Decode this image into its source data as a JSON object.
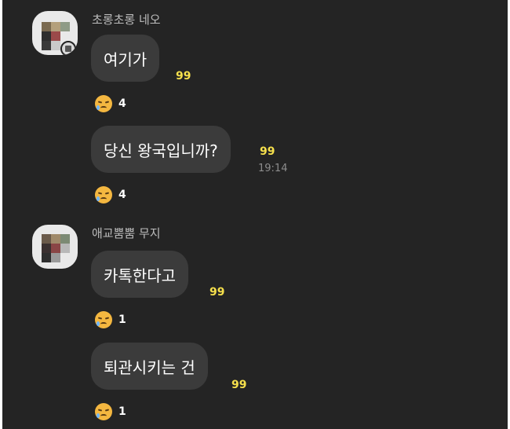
{
  "messages": [
    {
      "sender": "초롱초롱 네오",
      "bubbles": [
        {
          "text": "여기가",
          "unread": "99",
          "time": "",
          "reaction_count": "4"
        },
        {
          "text": "당신 왕국입니까?",
          "unread": "99",
          "time": "19:14",
          "reaction_count": "4"
        }
      ]
    },
    {
      "sender": "애교뿜뿜 무지",
      "bubbles": [
        {
          "text": "카톡한다고",
          "unread": "99",
          "time": "",
          "reaction_count": "1"
        },
        {
          "text": "퇴관시키는 건",
          "unread": "99",
          "time": "",
          "reaction_count": "1"
        }
      ]
    }
  ],
  "colors": {
    "background": "#242424",
    "bubble": "#3b3b3b",
    "unread": "#f6e04c",
    "reaction_emoji": "#f4b740"
  },
  "reaction_icon": "sad-tear-face-icon"
}
